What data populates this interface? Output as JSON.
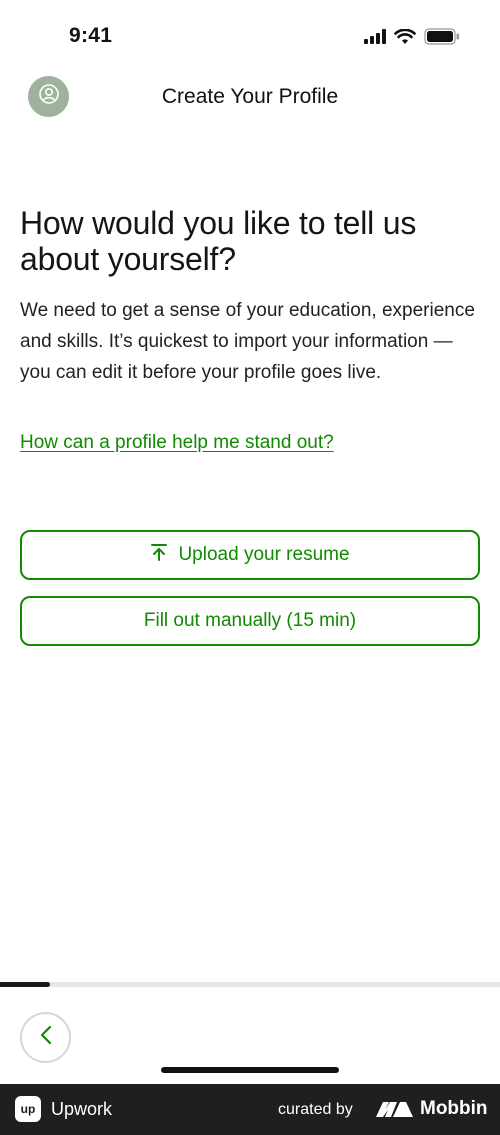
{
  "status_bar": {
    "time": "9:41",
    "icons": [
      "cellular-signal-icon",
      "wifi-icon",
      "battery-icon"
    ]
  },
  "header": {
    "title": "Create Your Profile",
    "avatar_icon": "user-circle-icon",
    "avatar_color": "#9fb29d"
  },
  "main": {
    "headline": "How would you like to tell us about yourself?",
    "body": "We need to get a sense of your education, experience and skills. It’s quickest to import your information — you can edit it before your profile goes live.",
    "help_link": "How can a profile help me stand out?",
    "upload_button": {
      "label": "Upload your resume",
      "icon": "upload-arrow-icon"
    },
    "manual_button": {
      "label": "Fill out manually (15 min)"
    }
  },
  "progress": {
    "fraction": 0.1
  },
  "navigation": {
    "back_icon": "chevron-left-icon"
  },
  "footer": {
    "app_logo_text": "up",
    "app_name": "Upwork",
    "curated_by": "curated by",
    "brand": "Mobbin"
  },
  "colors": {
    "accent": "#108a00",
    "footer_bg": "#1f1f1f",
    "progress_fill": "#1a1a1a",
    "progress_track": "#e6e6e6"
  }
}
